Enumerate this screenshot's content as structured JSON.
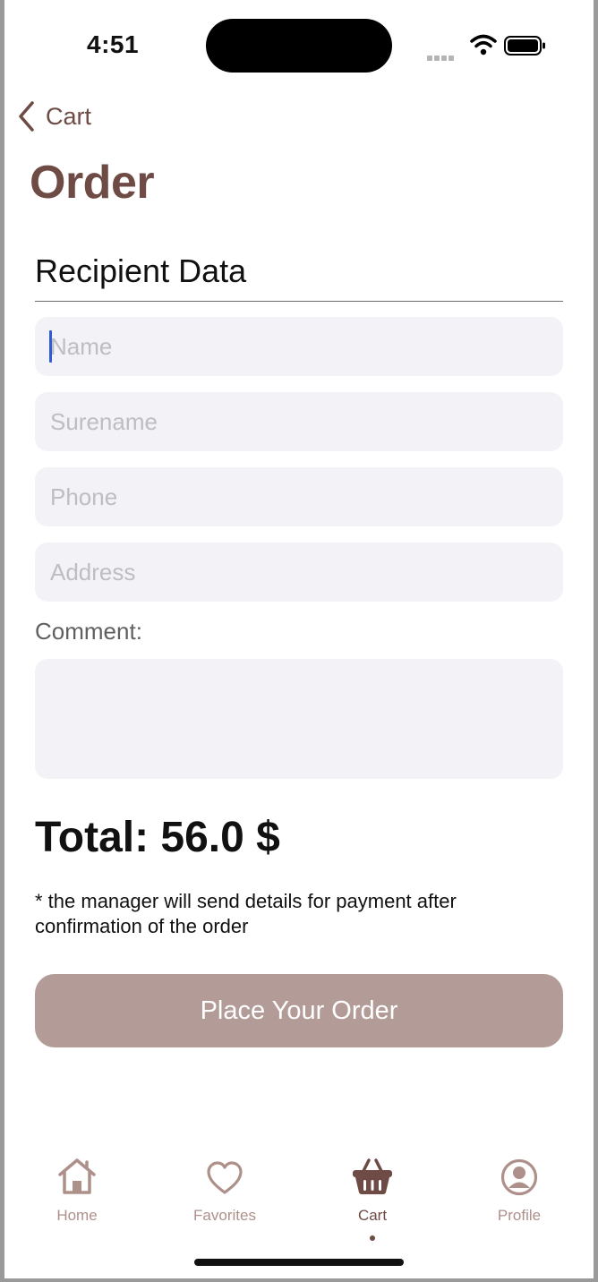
{
  "status_bar": {
    "time": "4:51"
  },
  "nav": {
    "back_label": "Cart"
  },
  "page": {
    "title": "Order"
  },
  "form": {
    "section_title": "Recipient Data",
    "name_placeholder": "Name",
    "surname_placeholder": "Surename",
    "phone_placeholder": "Phone",
    "address_placeholder": "Address",
    "comment_label": "Comment:"
  },
  "summary": {
    "total": "Total: 56.0 $",
    "note": "* the manager will send details for payment after confirmation of the order"
  },
  "actions": {
    "place_order_label": "Place Your Order"
  },
  "tab_bar": {
    "items": [
      {
        "label": "Home",
        "icon": "home-icon"
      },
      {
        "label": "Favorites",
        "icon": "heart-icon"
      },
      {
        "label": "Cart",
        "icon": "basket-icon",
        "active": true
      },
      {
        "label": "Profile",
        "icon": "profile-icon"
      }
    ]
  },
  "colors": {
    "accent": "#6e4b45",
    "button": "#b39c97",
    "tab_inactive": "#ae908b",
    "field_bg": "#f2f2f7"
  }
}
